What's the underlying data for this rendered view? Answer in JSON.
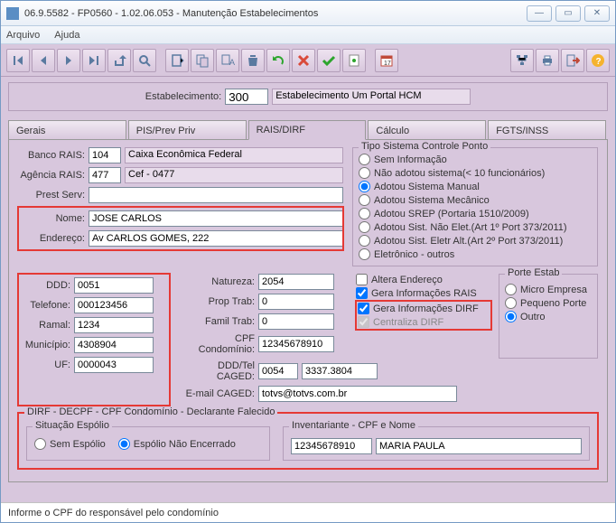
{
  "window": {
    "title": "06.9.5582 - FP0560 - 1.02.06.053 - Manutenção Estabelecimentos"
  },
  "menu": {
    "arquivo": "Arquivo",
    "ajuda": "Ajuda"
  },
  "estab": {
    "label": "Estabelecimento:",
    "code": "300",
    "name": "Estabelecimento Um Portal HCM"
  },
  "tabs": {
    "gerais": "Gerais",
    "pis": "PIS/Prev Priv",
    "rais": "RAIS/DIRF",
    "calculo": "Cálculo",
    "fgts": "FGTS/INSS"
  },
  "bank": {
    "banco_label": "Banco RAIS:",
    "banco": "104",
    "banco_nome": "Caixa Econômica Federal",
    "agencia_label": "Agência RAIS:",
    "agencia": "477",
    "agencia_nome": "Cef - 0477",
    "prest_label": "Prest Serv:",
    "prest": ""
  },
  "pessoa": {
    "nome_label": "Nome:",
    "nome": "JOSE CARLOS",
    "end_label": "Endereço:",
    "end": "Av CARLOS GOMES, 222"
  },
  "col1": {
    "ddd_label": "DDD:",
    "ddd": "0051",
    "tel_label": "Telefone:",
    "tel": "000123456",
    "ramal_label": "Ramal:",
    "ramal": "1234",
    "mun_label": "Município:",
    "mun": "4308904",
    "uf_label": "UF:",
    "uf": "0000043"
  },
  "col2": {
    "nat_label": "Natureza:",
    "nat": "2054",
    "prop_label": "Prop Trab:",
    "prop": "0",
    "famil_label": "Famil Trab:",
    "famil": "0",
    "cpfcond_label": "CPF Condomínio:",
    "cpfcond": "12345678910",
    "dddtel_label": "DDD/Tel CAGED:",
    "dddtel_ddd": "0054",
    "dddtel_tel": "3337.3804",
    "email_label": "E-mail CAGED:",
    "email": "totvs@totvs.com.br"
  },
  "checks": {
    "altera": "Altera Endereço",
    "gerarais": "Gera Informações RAIS",
    "geradirf": "Gera Informações DIRF",
    "centraliza": "Centraliza DIRF"
  },
  "ponto": {
    "legend": "Tipo Sistema Controle Ponto",
    "o1": "Sem Informação",
    "o2": "Não adotou sistema(< 10 funcionários)",
    "o3": "Adotou Sistema Manual",
    "o4": "Adotou Sistema Mecânico",
    "o5": "Adotou SREP (Portaria 1510/2009)",
    "o6": "Adotou Sist. Não Elet.(Art 1º Port 373/2011)",
    "o7": "Adotou Sist. Eletr Alt.(Art 2º Port 373/2011)",
    "o8": "Eletrônico - outros"
  },
  "porte": {
    "legend": "Porte Estab",
    "o1": "Micro Empresa",
    "o2": "Pequeno Porte",
    "o3": "Outro"
  },
  "dirf": {
    "legend": "DIRF - DECPF - CPF Condomínio - Declarante Falecido",
    "situacao_legend": "Situação Espólio",
    "sem": "Sem Espólio",
    "nao": "Espólio Não Encerrado",
    "invent_legend": "Inventariante - CPF e Nome",
    "invent_cpf": "12345678910",
    "invent_nome": "MARIA PAULA"
  },
  "status": "Informe o CPF do responsável pelo condomínio"
}
